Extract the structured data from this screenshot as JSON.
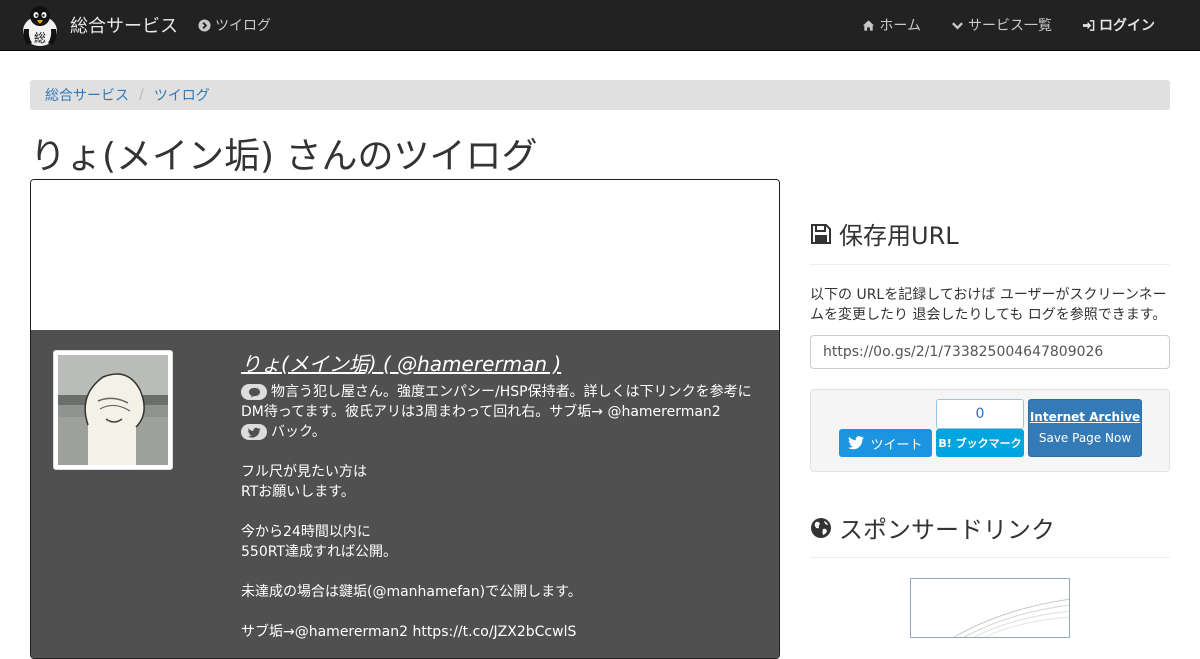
{
  "navbar": {
    "brand": "総合サービス",
    "logo_char": "総",
    "section": "ツイログ",
    "items": [
      {
        "label": "ホーム",
        "icon": "home-icon"
      },
      {
        "label": "サービス一覧",
        "icon": "chevron-down-icon"
      },
      {
        "label": "ログイン",
        "icon": "sign-in-icon"
      }
    ]
  },
  "breadcrumb": {
    "items": [
      "総合サービス",
      "ツイログ"
    ],
    "separator": "/"
  },
  "page": {
    "title": "りょ(メイン垢) さんのツイログ"
  },
  "profile": {
    "name": "りょ(メイン垢) ( @hamererman )",
    "bio_lines": [
      "物言う犯し屋さん。強度エンパシー/HSP保持者。詳しくは下リンクを参考に。",
      "DM待ってます。彼氏アリは3周まわって回れ右。サブ垢→ @hamererman2",
      "バック。",
      "",
      "フル尺が見たい方は",
      "RTお願いします。",
      "",
      "今から24時間以内に",
      "550RT達成すれば公開。",
      "",
      "未達成の場合は鍵垢(@manhamefan)で公開します。",
      "",
      "サブ垢→@hamererman2 https://t.co/JZX2bCcwlS"
    ]
  },
  "sidebar": {
    "save_heading": "保存用URL",
    "save_desc": "以下の URLを記録しておけば ユーザーがスクリーンネームを変更したり 退会したりしても ログを参照できます。",
    "save_url": "https://0o.gs/2/1/733825004647809026",
    "tweet_label": "ツイート",
    "hatena_count": "0",
    "hatena_label": "B! ブックマーク",
    "archive_title": "Internet Archive",
    "archive_action": "Save Page Now",
    "sponsor_heading": "スポンサードリンク"
  },
  "colors": {
    "navbar": "#222222",
    "link": "#337ab7",
    "profile_bg": "#505050",
    "twitter": "#1b95e0",
    "hatena": "#00a4de"
  }
}
